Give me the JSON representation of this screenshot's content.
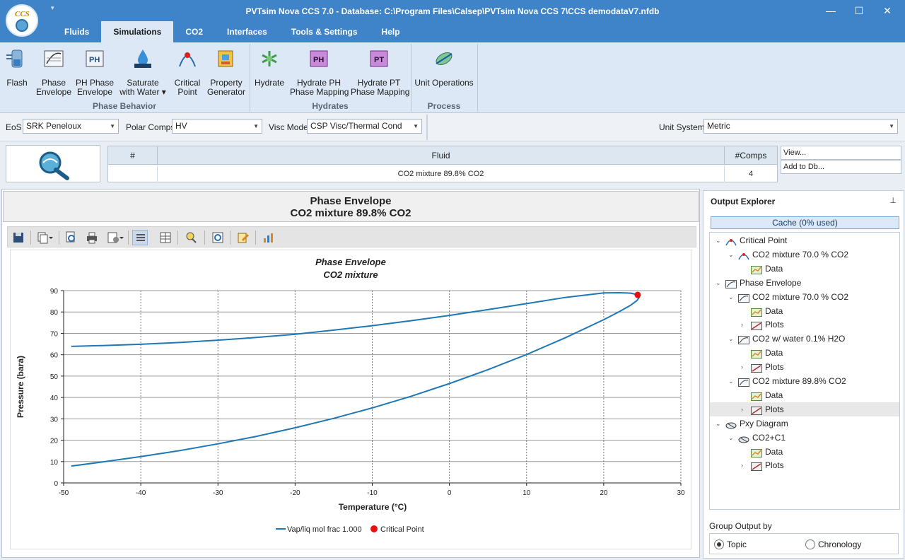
{
  "window": {
    "title": "PVTsim Nova CCS 7.0 - Database: C:\\Program Files\\Calsep\\PVTsim Nova CCS 7\\CCS demodataV7.nfdb",
    "logo_text": "CCS",
    "controls": {
      "minimize": "—",
      "maximize": "☐",
      "close": "✕"
    },
    "qat_arrow": "▾"
  },
  "menu_tabs": [
    {
      "label": "Fluids"
    },
    {
      "label": "Simulations",
      "active": true
    },
    {
      "label": "CO2"
    },
    {
      "label": "Interfaces"
    },
    {
      "label": "Tools & Settings"
    },
    {
      "label": "Help"
    }
  ],
  "ribbon": {
    "buttons": [
      {
        "label": "Flash",
        "icon": "flash-icon"
      },
      {
        "label": "Phase\nEnvelope",
        "icon": "phase-envelope-icon"
      },
      {
        "label": "PH Phase\nEnvelope",
        "icon": "ph-phase-envelope-icon"
      },
      {
        "label": "Saturate\nwith Water ▾",
        "icon": "saturate-water-icon"
      },
      {
        "label": "Critical\nPoint",
        "icon": "critical-point-icon"
      },
      {
        "label": "Property\nGenerator",
        "icon": "property-generator-icon"
      },
      {
        "label": "Hydrate",
        "icon": "hydrate-icon"
      },
      {
        "label": "Hydrate PH\nPhase Mapping",
        "icon": "hydrate-ph-icon"
      },
      {
        "label": "Hydrate PT\nPhase Mapping",
        "icon": "hydrate-pt-icon"
      },
      {
        "label": "Unit Operations",
        "icon": "unit-operations-icon"
      }
    ],
    "groups": [
      "Phase Behavior",
      "Hydrates",
      "Process"
    ]
  },
  "settings": {
    "eos_label": "EoS",
    "eos_value": "SRK Peneloux",
    "polar_label": "Polar Comps",
    "polar_value": "HV",
    "visc_label": "Visc Model",
    "visc_value": "CSP Visc/Thermal Cond",
    "unit_label": "Unit System",
    "unit_value": "Metric",
    "dropdown_arrow": "▼"
  },
  "fluid_table": {
    "headers": [
      "#",
      "Fluid",
      "#Comps"
    ],
    "row": {
      "num": "",
      "fluid": "CO2 mixture 89.8% CO2",
      "comps": "4"
    },
    "view_button": "View...",
    "add_button": "Add to Db..."
  },
  "plot_header": {
    "line1": "Phase Envelope",
    "line2": "CO2 mixture 89.8% CO2"
  },
  "chart_data": {
    "type": "line",
    "title": "Phase Envelope",
    "subtitle": "CO2 mixture",
    "xlabel": "Temperature (°C)",
    "ylabel": "Pressure (bara)",
    "xlim": [
      -50,
      30
    ],
    "ylim": [
      0,
      90
    ],
    "x_ticks": [
      -50,
      -40,
      -30,
      -20,
      -10,
      0,
      10,
      20,
      30
    ],
    "y_ticks": [
      0,
      10,
      20,
      30,
      40,
      50,
      60,
      70,
      80,
      90
    ],
    "grid": "dotted vertical, solid horizontal",
    "legend_position": "bottom",
    "colors": {
      "envelope": "#1f77b4",
      "critical": "#e8100e"
    },
    "series": [
      {
        "name": "Vap/liq mol frac 1.000",
        "x": [
          -49,
          -45,
          -40,
          -35,
          -30,
          -25,
          -20,
          -15,
          -10,
          -5,
          0,
          5,
          10,
          15,
          20,
          22,
          23.5,
          24.3,
          24.6,
          24.5
        ],
        "y": [
          7.9,
          9.8,
          12.3,
          15.1,
          18.3,
          21.8,
          25.8,
          30.2,
          35.1,
          40.5,
          46.5,
          53.0,
          60.1,
          67.9,
          76.4,
          80.1,
          83.2,
          85.3,
          86.9,
          88.0
        ]
      },
      {
        "name": "",
        "x": [
          24.5,
          23.5,
          22,
          20,
          15,
          10,
          5,
          0,
          -5,
          -10,
          -15,
          -20,
          -25,
          -30,
          -35,
          -40,
          -45,
          -49
        ],
        "y": [
          88.0,
          88.8,
          89.0,
          88.9,
          86.8,
          83.9,
          81.1,
          78.4,
          75.9,
          73.6,
          71.5,
          69.6,
          68.1,
          66.8,
          65.7,
          64.9,
          64.3,
          63.9
        ]
      }
    ],
    "critical_point": {
      "name": "Critical Point",
      "x": 24.4,
      "y": 88.0
    }
  },
  "explorer": {
    "title": "Output Explorer",
    "pin": "⊥",
    "cache": "Cache (0% used)",
    "tree": [
      {
        "level": 0,
        "label": "Critical Point",
        "icon": "critical-point-icon",
        "exp": "⌄"
      },
      {
        "level": 1,
        "label": "CO2 mixture 70.0 % CO2",
        "icon": "critical-point-icon",
        "exp": "⌄"
      },
      {
        "level": 2,
        "label": "Data",
        "icon": "data-icon",
        "exp": ""
      },
      {
        "level": 0,
        "label": "Phase Envelope",
        "icon": "phase-envelope-icon",
        "exp": "⌄"
      },
      {
        "level": 1,
        "label": "CO2 mixture 70.0 % CO2",
        "icon": "phase-envelope-icon",
        "exp": "⌄"
      },
      {
        "level": 2,
        "label": "Data",
        "icon": "data-icon",
        "exp": ""
      },
      {
        "level": 2,
        "label": "Plots",
        "icon": "plots-icon",
        "exp": "›"
      },
      {
        "level": 1,
        "label": "CO2 w/ water 0.1% H2O",
        "icon": "phase-envelope-icon",
        "exp": "⌄"
      },
      {
        "level": 2,
        "label": "Data",
        "icon": "data-icon",
        "exp": ""
      },
      {
        "level": 2,
        "label": "Plots",
        "icon": "plots-icon",
        "exp": "›"
      },
      {
        "level": 1,
        "label": "CO2 mixture 89.8% CO2",
        "icon": "phase-envelope-icon",
        "exp": "⌄"
      },
      {
        "level": 2,
        "label": "Data",
        "icon": "data-icon",
        "exp": ""
      },
      {
        "level": 2,
        "label": "Plots",
        "icon": "plots-icon",
        "exp": "›",
        "selected": true
      },
      {
        "level": 0,
        "label": "Pxy Diagram",
        "icon": "pxy-diagram-icon",
        "exp": "⌄"
      },
      {
        "level": 1,
        "label": "CO2+C1",
        "icon": "pxy-diagram-icon",
        "exp": "⌄"
      },
      {
        "level": 2,
        "label": "Data",
        "icon": "data-icon",
        "exp": ""
      },
      {
        "level": 2,
        "label": "Plots",
        "icon": "plots-icon",
        "exp": "›"
      }
    ],
    "group_output_label": "Group Output by",
    "group_options": [
      {
        "label": "Topic",
        "checked": true
      },
      {
        "label": "Chronology",
        "checked": false
      }
    ]
  }
}
